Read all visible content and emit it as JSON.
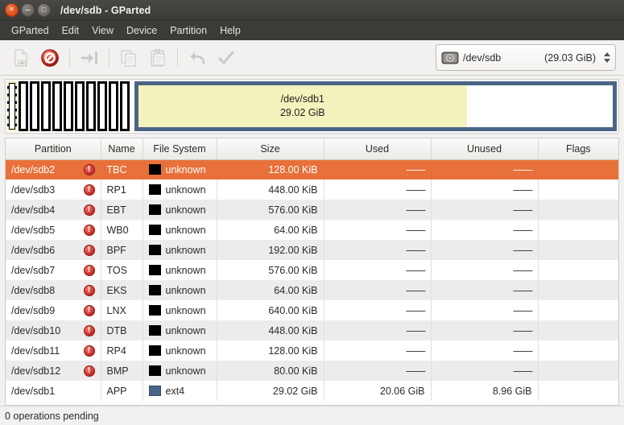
{
  "window": {
    "title": "/dev/sdb - GParted",
    "controls": [
      {
        "name": "close",
        "glyph": "×"
      },
      {
        "name": "minimize",
        "glyph": "−"
      },
      {
        "name": "maximize",
        "glyph": "□"
      }
    ]
  },
  "menubar": {
    "items": [
      "GParted",
      "Edit",
      "View",
      "Device",
      "Partition",
      "Help"
    ]
  },
  "toolbar": {
    "buttons": [
      {
        "name": "new-partition-button",
        "icon": "new-document-icon",
        "enabled": false
      },
      {
        "name": "delete-partition-button",
        "icon": "delete-prohibited-icon",
        "enabled": true
      },
      {
        "name": "resize-move-button",
        "icon": "resize-move-arrow-icon",
        "enabled": false
      },
      {
        "name": "copy-button",
        "icon": "copy-icon",
        "enabled": false
      },
      {
        "name": "paste-button",
        "icon": "paste-icon",
        "enabled": false
      },
      {
        "name": "undo-button",
        "icon": "undo-arrow-icon",
        "enabled": false
      },
      {
        "name": "apply-button",
        "icon": "apply-checkmark-icon",
        "enabled": false
      }
    ],
    "device_selector": {
      "icon": "hard-disk-icon",
      "device": "/dev/sdb",
      "size": "(29.03 GiB)"
    }
  },
  "graphic": {
    "small_partitions_count": 11,
    "selected_small_index": 0,
    "main_partition": {
      "label": "/dev/sdb1",
      "size": "29.02 GiB",
      "used_percent": 69.2,
      "border_color": "#4a6585",
      "used_color": "#f5f3bd",
      "unused_color": "#ffffff"
    }
  },
  "table": {
    "columns": [
      "Partition",
      "Name",
      "File System",
      "Size",
      "Used",
      "Unused",
      "Flags"
    ],
    "rows": [
      {
        "partition": "/dev/sdb2",
        "warning": true,
        "name": "TBC",
        "fs": "unknown",
        "fs_color": "#000000",
        "size": "128.00 KiB",
        "used": "——",
        "unused": "——",
        "flags": "",
        "selected": true
      },
      {
        "partition": "/dev/sdb3",
        "warning": true,
        "name": "RP1",
        "fs": "unknown",
        "fs_color": "#000000",
        "size": "448.00 KiB",
        "used": "——",
        "unused": "——",
        "flags": "",
        "selected": false
      },
      {
        "partition": "/dev/sdb4",
        "warning": true,
        "name": "EBT",
        "fs": "unknown",
        "fs_color": "#000000",
        "size": "576.00 KiB",
        "used": "——",
        "unused": "——",
        "flags": "",
        "selected": false
      },
      {
        "partition": "/dev/sdb5",
        "warning": true,
        "name": "WB0",
        "fs": "unknown",
        "fs_color": "#000000",
        "size": "64.00 KiB",
        "used": "——",
        "unused": "——",
        "flags": "",
        "selected": false
      },
      {
        "partition": "/dev/sdb6",
        "warning": true,
        "name": "BPF",
        "fs": "unknown",
        "fs_color": "#000000",
        "size": "192.00 KiB",
        "used": "——",
        "unused": "——",
        "flags": "",
        "selected": false
      },
      {
        "partition": "/dev/sdb7",
        "warning": true,
        "name": "TOS",
        "fs": "unknown",
        "fs_color": "#000000",
        "size": "576.00 KiB",
        "used": "——",
        "unused": "——",
        "flags": "",
        "selected": false
      },
      {
        "partition": "/dev/sdb8",
        "warning": true,
        "name": "EKS",
        "fs": "unknown",
        "fs_color": "#000000",
        "size": "64.00 KiB",
        "used": "——",
        "unused": "——",
        "flags": "",
        "selected": false
      },
      {
        "partition": "/dev/sdb9",
        "warning": true,
        "name": "LNX",
        "fs": "unknown",
        "fs_color": "#000000",
        "size": "640.00 KiB",
        "used": "——",
        "unused": "——",
        "flags": "",
        "selected": false
      },
      {
        "partition": "/dev/sdb10",
        "warning": true,
        "name": "DTB",
        "fs": "unknown",
        "fs_color": "#000000",
        "size": "448.00 KiB",
        "used": "——",
        "unused": "——",
        "flags": "",
        "selected": false
      },
      {
        "partition": "/dev/sdb11",
        "warning": true,
        "name": "RP4",
        "fs": "unknown",
        "fs_color": "#000000",
        "size": "128.00 KiB",
        "used": "——",
        "unused": "——",
        "flags": "",
        "selected": false
      },
      {
        "partition": "/dev/sdb12",
        "warning": true,
        "name": "BMP",
        "fs": "unknown",
        "fs_color": "#000000",
        "size": "80.00 KiB",
        "used": "——",
        "unused": "——",
        "flags": "",
        "selected": false
      },
      {
        "partition": "/dev/sdb1",
        "warning": false,
        "name": "APP",
        "fs": "ext4",
        "fs_color": "#4a6585",
        "size": "29.02 GiB",
        "used": "20.06 GiB",
        "unused": "8.96 GiB",
        "flags": "",
        "selected": false
      }
    ]
  },
  "statusbar": {
    "text": "0 operations pending"
  },
  "colors": {
    "selection": "#e8703a",
    "titlebar": "#3b3a36",
    "menubar": "#3c3b37",
    "ext4": "#4a6585",
    "unknown": "#000000"
  }
}
